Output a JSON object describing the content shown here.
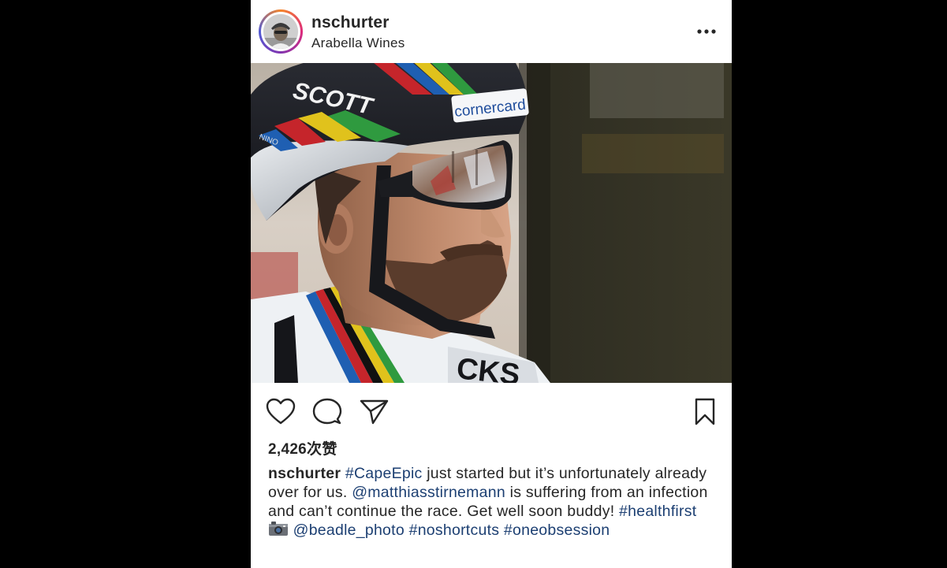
{
  "post": {
    "username": "nschurter",
    "location": "Arabella Wines",
    "more_icon": "more-horizontal-icon",
    "photo": {
      "helmet_brand": "SCOTT",
      "helmet_sponsor": "cornercard",
      "helmet_small_text": "NINO"
    },
    "actions": {
      "like_icon": "heart-outline-icon",
      "comment_icon": "comment-bubble-icon",
      "share_icon": "paper-plane-icon",
      "save_icon": "bookmark-outline-icon"
    },
    "likes": "2,426次赞",
    "caption": {
      "user": "nschurter",
      "tag_capeepic": "#CapeEpic",
      "text_1": " just started but it’s unfortunately already over for us. ",
      "mention_1": "@matthiasstirnemann",
      "text_2": " is suffering from an infection and can’t continue the race. Get well soon buddy! ",
      "tag_healthfirst": "#healthfirst",
      "camera_emoji": "camera-emoji-icon",
      "mention_2": "@beadle_photo",
      "tag_noshortcuts": "#noshortcuts",
      "tag_oneobsession": "#oneobsession"
    },
    "colors": {
      "text": "#262626",
      "link": "#1c3f72",
      "background": "#ffffff"
    }
  }
}
